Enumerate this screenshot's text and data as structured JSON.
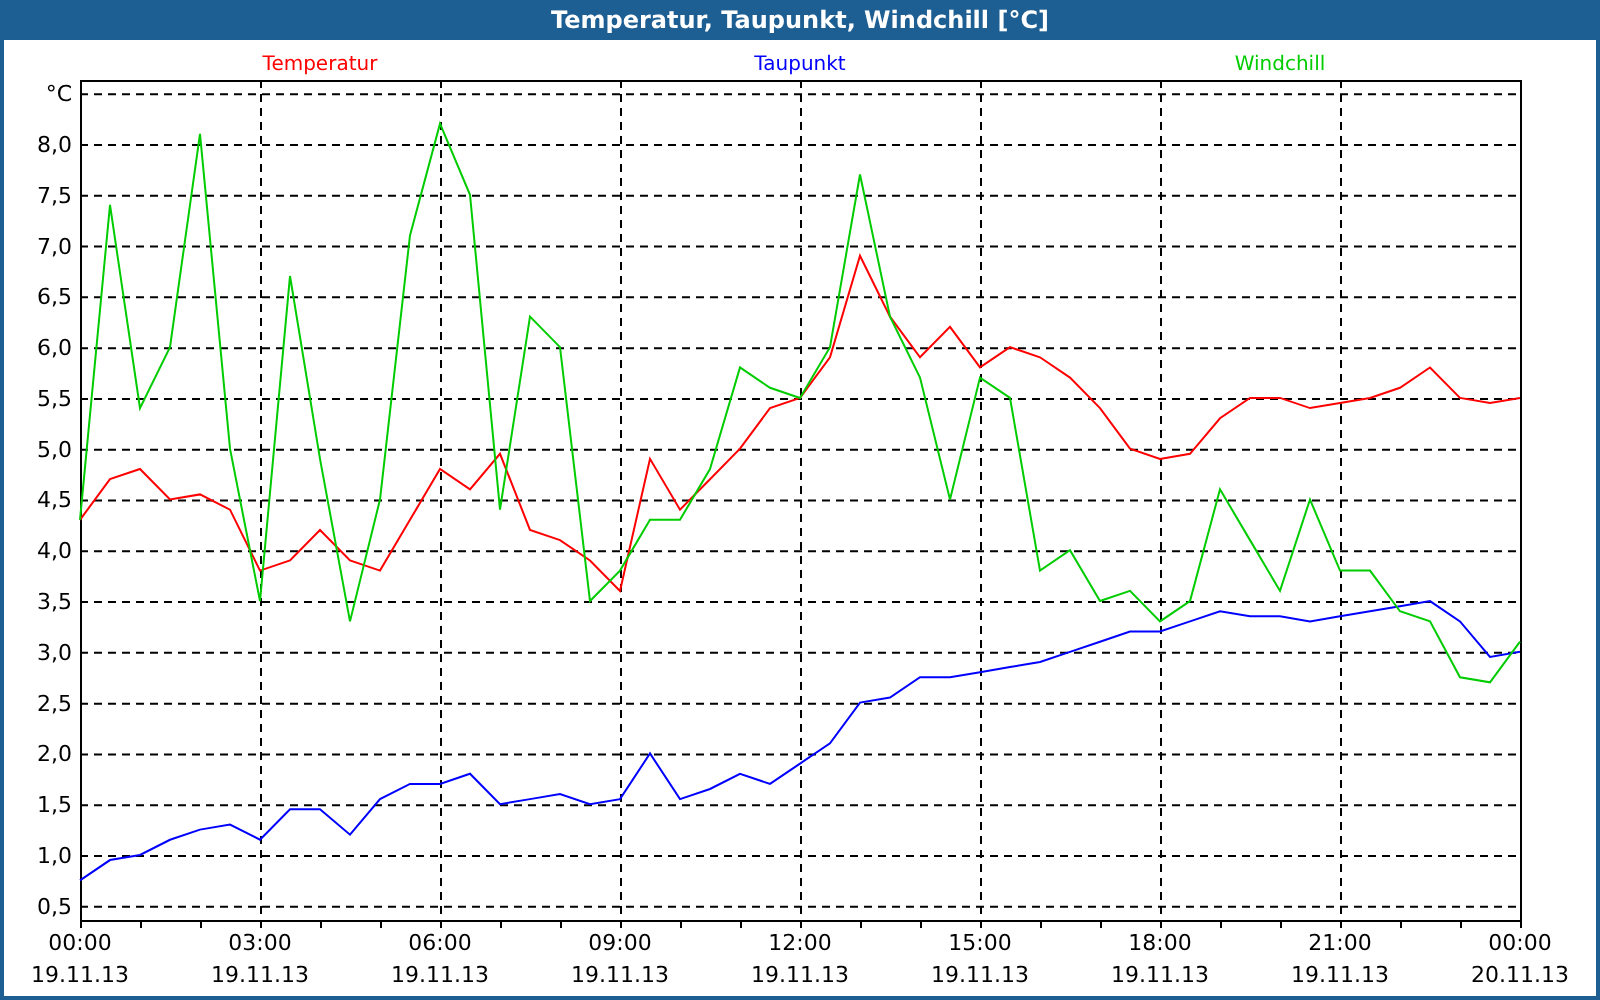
{
  "window": {
    "title": "Temperatur, Taupunkt, Windchill [°C]"
  },
  "chart_data": {
    "type": "line",
    "grid": true,
    "ylabel": "°C",
    "ylim": [
      0.36,
      8.63
    ],
    "categories": [
      "00:00\n19.11.13",
      null,
      null,
      null,
      null,
      null,
      "03:00\n19.11.13",
      null,
      null,
      null,
      null,
      null,
      "06:00\n19.11.13",
      null,
      null,
      null,
      null,
      null,
      "09:00\n19.11.13",
      null,
      null,
      null,
      null,
      null,
      "12:00\n19.11.13",
      null,
      null,
      null,
      null,
      null,
      "15:00\n19.11.13",
      null,
      null,
      null,
      null,
      null,
      "18:00\n19.11.13",
      null,
      null,
      null,
      null,
      null,
      "21:00\n19.11.13",
      null,
      null,
      null,
      null,
      null,
      "00:00\n20.11.13"
    ],
    "series": [
      {
        "name": "Temperatur",
        "color": "#ff0000",
        "values": [
          4.3,
          4.7,
          4.8,
          4.5,
          4.55,
          4.4,
          3.8,
          3.9,
          4.2,
          3.9,
          3.8,
          4.3,
          4.8,
          4.6,
          4.95,
          4.2,
          4.1,
          3.9,
          3.6,
          4.9,
          4.4,
          4.7,
          5.0,
          5.4,
          5.5,
          5.9,
          6.9,
          6.3,
          5.9,
          6.2,
          5.8,
          6.0,
          5.9,
          5.7,
          5.4,
          5.0,
          4.9,
          4.95,
          5.3,
          5.5,
          5.5,
          5.4,
          5.45,
          5.5,
          5.6,
          5.8,
          5.5,
          5.45,
          5.5
        ]
      },
      {
        "name": "Taupunkt",
        "color": "#0000ff",
        "values": [
          0.75,
          0.95,
          1.0,
          1.15,
          1.25,
          1.3,
          1.15,
          1.45,
          1.45,
          1.2,
          1.55,
          1.7,
          1.7,
          1.8,
          1.5,
          1.55,
          1.6,
          1.5,
          1.55,
          2.0,
          1.55,
          1.65,
          1.8,
          1.7,
          1.9,
          2.1,
          2.5,
          2.55,
          2.75,
          2.75,
          2.8,
          2.85,
          2.9,
          3.0,
          3.1,
          3.2,
          3.2,
          3.3,
          3.4,
          3.35,
          3.35,
          3.3,
          3.35,
          3.4,
          3.45,
          3.5,
          3.3,
          2.95,
          3.0
        ]
      },
      {
        "name": "Windchill",
        "color": "#00cc00",
        "values": [
          4.3,
          7.4,
          5.4,
          6.0,
          8.1,
          5.0,
          3.5,
          6.7,
          4.9,
          3.3,
          4.5,
          7.1,
          8.2,
          7.5,
          4.4,
          6.3,
          6.0,
          3.5,
          3.8,
          4.3,
          4.3,
          4.8,
          5.8,
          5.6,
          5.5,
          6.0,
          7.7,
          6.3,
          5.7,
          4.5,
          5.7,
          5.5,
          3.8,
          4.0,
          3.5,
          3.6,
          3.3,
          3.5,
          4.6,
          4.1,
          3.6,
          4.5,
          3.8,
          3.8,
          3.4,
          3.3,
          2.75,
          2.7,
          3.1
        ]
      }
    ],
    "yticks": [
      {
        "value": 0.5,
        "label": "0,5"
      },
      {
        "value": 1,
        "label": "1,0"
      },
      {
        "value": 1.5,
        "label": "1,5"
      },
      {
        "value": 2,
        "label": "2,0"
      },
      {
        "value": 2.5,
        "label": "2,5"
      },
      {
        "value": 3,
        "label": "3,0"
      },
      {
        "value": 3.5,
        "label": "3,5"
      },
      {
        "value": 4,
        "label": "4,0"
      },
      {
        "value": 4.5,
        "label": "4,5"
      },
      {
        "value": 5,
        "label": "5,0"
      },
      {
        "value": 5.5,
        "label": "5,5"
      },
      {
        "value": 6,
        "label": "6,0"
      },
      {
        "value": 6.5,
        "label": "6,5"
      },
      {
        "value": 7,
        "label": "7,0"
      },
      {
        "value": 7.5,
        "label": "7,5"
      },
      {
        "value": 8,
        "label": "8,0"
      }
    ]
  }
}
